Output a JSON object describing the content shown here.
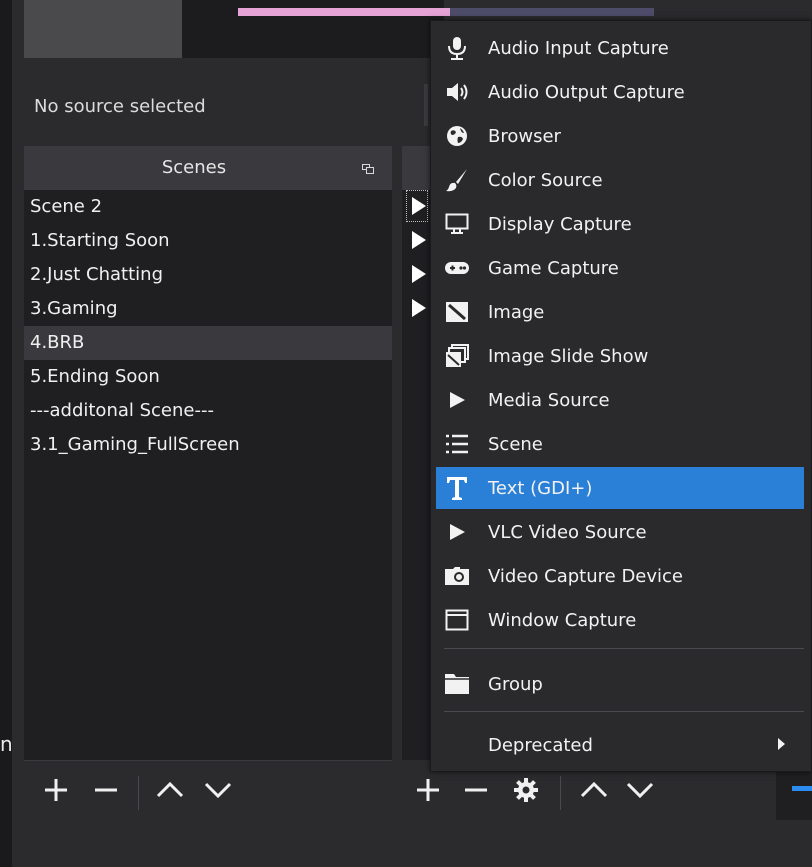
{
  "properties_bar": {
    "no_source_text": "No source selected"
  },
  "scenes": {
    "title": "Scenes",
    "items": [
      {
        "label": "Scene 2"
      },
      {
        "label": "1.Starting Soon"
      },
      {
        "label": "2.Just Chatting"
      },
      {
        "label": "3.Gaming"
      },
      {
        "label": "4.BRB",
        "selected": true
      },
      {
        "label": "5.Ending Soon"
      },
      {
        "label": "---additonal Scene---"
      },
      {
        "label": "3.1_Gaming_FullScreen"
      }
    ]
  },
  "scenes_toolbar": {
    "add_icon": "plus-icon",
    "remove_icon": "minus-icon",
    "move_up_icon": "chevron-up-icon",
    "move_down_icon": "chevron-down-icon"
  },
  "sources_toolbar": {
    "add_icon": "plus-icon",
    "remove_icon": "minus-icon",
    "properties_icon": "gear-icon",
    "move_up_icon": "chevron-up-icon",
    "move_down_icon": "chevron-down-icon"
  },
  "add_source_menu": {
    "items": [
      {
        "label": "Audio Input Capture",
        "icon": "microphone-icon"
      },
      {
        "label": "Audio Output Capture",
        "icon": "speaker-icon"
      },
      {
        "label": "Browser",
        "icon": "globe-icon"
      },
      {
        "label": "Color Source",
        "icon": "paintbrush-icon"
      },
      {
        "label": "Display Capture",
        "icon": "monitor-icon"
      },
      {
        "label": "Game Capture",
        "icon": "gamepad-icon"
      },
      {
        "label": "Image",
        "icon": "image-icon"
      },
      {
        "label": "Image Slide Show",
        "icon": "slideshow-icon"
      },
      {
        "label": "Media Source",
        "icon": "play-icon"
      },
      {
        "label": "Scene",
        "icon": "list-icon"
      },
      {
        "label": "Text (GDI+)",
        "icon": "text-icon",
        "highlighted": true
      },
      {
        "label": "VLC Video Source",
        "icon": "play-icon"
      },
      {
        "label": "Video Capture Device",
        "icon": "camera-icon"
      },
      {
        "label": "Window Capture",
        "icon": "window-icon"
      }
    ],
    "group": {
      "label": "Group",
      "icon": "folder-icon"
    },
    "deprecated": {
      "label": "Deprecated",
      "icon": "submenu-arrow-icon"
    }
  },
  "colors": {
    "menu_highlight": "#2a7fd6",
    "accent_blue": "#2d8cf0",
    "progress_pink": "#e6a3d6"
  }
}
